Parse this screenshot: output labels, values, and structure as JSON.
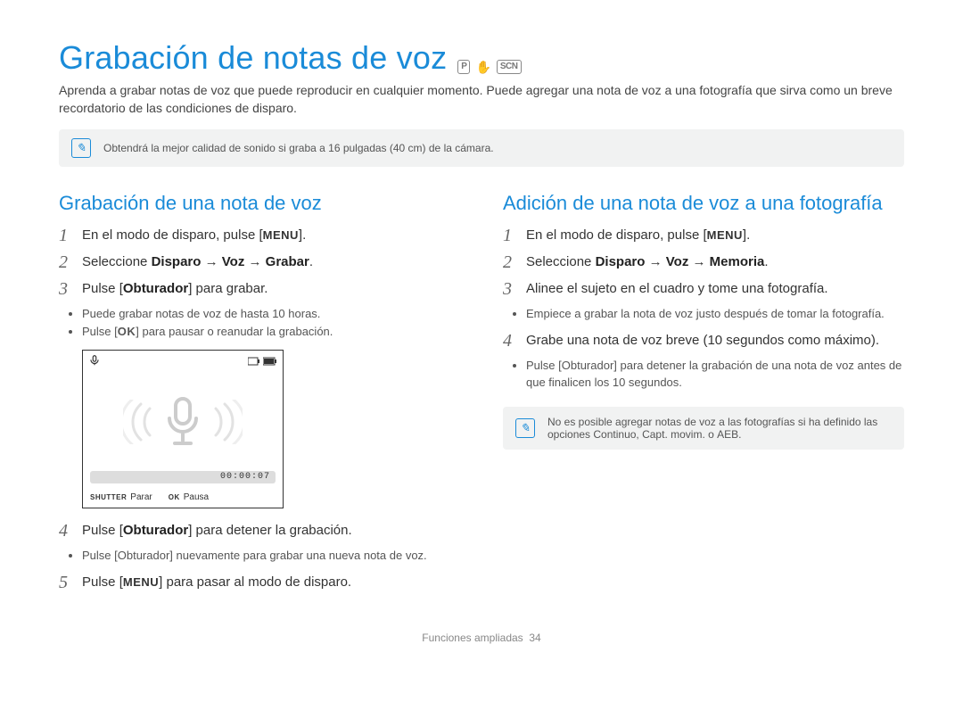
{
  "title": "Grabación de notas de voz",
  "mode_icons": [
    "P",
    "✋",
    "SCN"
  ],
  "intro": "Aprenda a grabar notas de voz que puede reproducir en cualquier momento. Puede agregar una nota de voz a una fotografía que sirva como un breve recordatorio de las condiciones de disparo.",
  "top_note": "Obtendrá la mejor calidad de sonido si graba a 16 pulgadas (40 cm) de la cámara.",
  "keys": {
    "menu": "MENU",
    "ok": "OK",
    "shutter": "SHUTTER"
  },
  "left": {
    "heading": "Grabación de una nota de voz",
    "steps": {
      "s1": {
        "pre": "En el modo de disparo, pulse [",
        "key": "MENU",
        "post": "]."
      },
      "s2_html": "Seleccione <b>Disparo</b> → <b>Voz</b> → <b>Grabar</b>.",
      "s3_html": "Pulse [<b>Obturador</b>] para grabar.",
      "s3_bullets": [
        "Puede grabar notas de voz de hasta 10 horas.",
        "Pulse [ OK ] para pausar o reanudar la grabación."
      ],
      "lcd": {
        "time": "00:00:07",
        "stop_label": "Parar",
        "pause_label": "Pausa"
      },
      "s4_html": "Pulse [<b>Obturador</b>] para detener la grabación.",
      "s4_bullets": [
        "Pulse [Obturador] nuevamente para grabar una nueva nota de voz."
      ],
      "s5": {
        "pre": "Pulse [",
        "key": "MENU",
        "post": "] para pasar al modo de disparo."
      }
    }
  },
  "right": {
    "heading": "Adición de una nota de voz a una fotografía",
    "steps": {
      "s1": {
        "pre": "En el modo de disparo, pulse [",
        "key": "MENU",
        "post": "]."
      },
      "s2_html": "Seleccione <b>Disparo</b> → <b>Voz</b> → <b>Memoria</b>.",
      "s3": "Alinee el sujeto en el cuadro y tome una fotografía.",
      "s3_bullets": [
        "Empiece a grabar la nota de voz justo después de tomar la fotografía."
      ],
      "s4": "Grabe una nota de voz breve (10 segundos como máximo).",
      "s4_bullets": [
        "Pulse [Obturador] para detener la grabación de una nota de voz antes de que finalicen los 10 segundos."
      ]
    },
    "note_html": "No es posible agregar notas de voz a las fotografías si ha definido las opciones <b>Continuo</b>, <b>Capt. movim.</b> o <b>AEB</b>."
  },
  "footer": {
    "label": "Funciones ampliadas",
    "page": "34"
  }
}
